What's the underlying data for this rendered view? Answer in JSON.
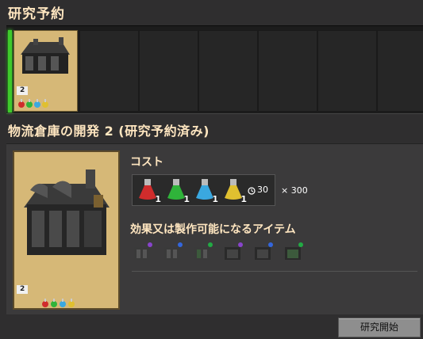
{
  "queue": {
    "title": "研究予約",
    "item": {
      "level": "2"
    }
  },
  "technology": {
    "title": "物流倉庫の開発 2 (研究予約済み)",
    "level": "2",
    "cost_label": "コスト",
    "cost_items": [
      {
        "name": "red-science-pack",
        "count": "1",
        "color": "#d02c2c"
      },
      {
        "name": "green-science-pack",
        "count": "1",
        "color": "#2fb43a"
      },
      {
        "name": "blue-science-pack",
        "count": "1",
        "color": "#3aa8e0"
      },
      {
        "name": "yellow-science-pack",
        "count": "1",
        "color": "#e0c030"
      }
    ],
    "time": "30",
    "multiplier": "× 300",
    "unlock_label": "効果又は製作可能になるアイテム",
    "unlocks": [
      {
        "name": "chest-icon-purple",
        "dot": "#8844cc"
      },
      {
        "name": "chest-icon-blue",
        "dot": "#3366dd"
      },
      {
        "name": "chest-icon-green",
        "dot": "#22aa44"
      },
      {
        "name": "chest-icon-purple-2",
        "dot": "#8844cc"
      },
      {
        "name": "chest-icon-blue-2",
        "dot": "#3366dd"
      },
      {
        "name": "chest-icon-green-2",
        "dot": "#22aa44"
      }
    ]
  },
  "buttons": {
    "start_research": "研究開始"
  }
}
